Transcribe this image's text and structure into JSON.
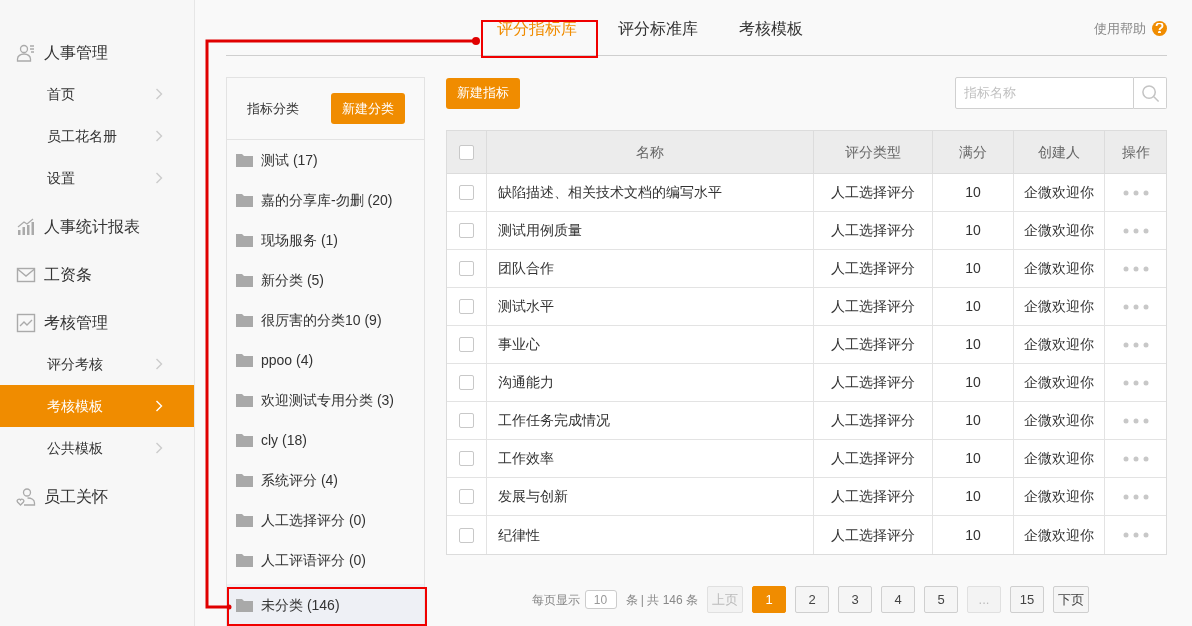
{
  "sidebar": {
    "groups": [
      {
        "title": "人事管理",
        "items": [
          {
            "label": "首页",
            "selected": false
          },
          {
            "label": "员工花名册",
            "selected": false
          },
          {
            "label": "设置",
            "selected": false
          }
        ]
      },
      {
        "title": "人事统计报表"
      },
      {
        "title": "工资条"
      },
      {
        "title": "考核管理",
        "items": [
          {
            "label": "评分考核",
            "selected": false
          },
          {
            "label": "考核模板",
            "selected": true
          },
          {
            "label": "公共模板",
            "selected": false
          }
        ]
      },
      {
        "title": "员工关怀"
      }
    ]
  },
  "tabs": [
    {
      "label": "评分指标库",
      "selected": true
    },
    {
      "label": "评分标准库",
      "selected": false
    },
    {
      "label": "考核模板",
      "selected": false
    }
  ],
  "help": "使用帮助",
  "categories": {
    "title": "指标分类",
    "new_button": "新建分类",
    "items": [
      {
        "label": "测试 (17)",
        "selected": false
      },
      {
        "label": "嘉的分享库-勿删 (20)",
        "selected": false
      },
      {
        "label": "现场服务 (1)",
        "selected": false
      },
      {
        "label": "新分类 (5)",
        "selected": false
      },
      {
        "label": "很厉害的分类10 (9)",
        "selected": false
      },
      {
        "label": "ppoo (4)",
        "selected": false
      },
      {
        "label": "欢迎测试专用分类 (3)",
        "selected": false
      },
      {
        "label": "cly (18)",
        "selected": false
      },
      {
        "label": "系统评分 (4)",
        "selected": false
      },
      {
        "label": "人工选择评分 (0)",
        "selected": false
      },
      {
        "label": "人工评语评分 (0)",
        "selected": false
      },
      {
        "label": "未分类 (146)",
        "selected": true
      }
    ]
  },
  "new_indicator_button": "新建指标",
  "search": {
    "placeholder": "指标名称"
  },
  "table": {
    "header_checked": false,
    "columns": [
      "名称",
      "评分类型",
      "满分",
      "创建人",
      "操作"
    ],
    "rows": [
      {
        "checked": false,
        "cells": [
          "缺陷描述、相关技术文档的编写水平",
          "人工选择评分",
          "10",
          "企微欢迎你"
        ]
      },
      {
        "checked": false,
        "cells": [
          "测试用例质量",
          "人工选择评分",
          "10",
          "企微欢迎你"
        ]
      },
      {
        "checked": false,
        "cells": [
          "团队合作",
          "人工选择评分",
          "10",
          "企微欢迎你"
        ]
      },
      {
        "checked": false,
        "cells": [
          "测试水平",
          "人工选择评分",
          "10",
          "企微欢迎你"
        ]
      },
      {
        "checked": false,
        "cells": [
          "事业心",
          "人工选择评分",
          "10",
          "企微欢迎你"
        ]
      },
      {
        "checked": false,
        "cells": [
          "沟通能力",
          "人工选择评分",
          "10",
          "企微欢迎你"
        ]
      },
      {
        "checked": false,
        "cells": [
          "工作任务完成情况",
          "人工选择评分",
          "10",
          "企微欢迎你"
        ]
      },
      {
        "checked": false,
        "cells": [
          "工作效率",
          "人工选择评分",
          "10",
          "企微欢迎你"
        ]
      },
      {
        "checked": false,
        "cells": [
          "发展与创新",
          "人工选择评分",
          "10",
          "企微欢迎你"
        ]
      },
      {
        "checked": false,
        "cells": [
          "纪律性",
          "人工选择评分",
          "10",
          "企微欢迎你"
        ]
      }
    ]
  },
  "pagination": {
    "per_page_label": "每页显示",
    "per_page": "10",
    "summary": "条 | 共 146 条",
    "buttons": [
      {
        "kind": "nav",
        "label": "上页",
        "disabled": true,
        "selected": false
      },
      {
        "kind": "page",
        "label": "1",
        "disabled": false,
        "selected": true
      },
      {
        "kind": "page",
        "label": "2",
        "disabled": false,
        "selected": false
      },
      {
        "kind": "page",
        "label": "3",
        "disabled": false,
        "selected": false
      },
      {
        "kind": "page",
        "label": "4",
        "disabled": false,
        "selected": false
      },
      {
        "kind": "page",
        "label": "5",
        "disabled": false,
        "selected": false
      },
      {
        "kind": "gap",
        "label": "...",
        "disabled": true,
        "selected": false
      },
      {
        "kind": "page",
        "label": "15",
        "disabled": false,
        "selected": false
      },
      {
        "kind": "nav",
        "label": "下页",
        "disabled": false,
        "selected": false
      }
    ]
  }
}
